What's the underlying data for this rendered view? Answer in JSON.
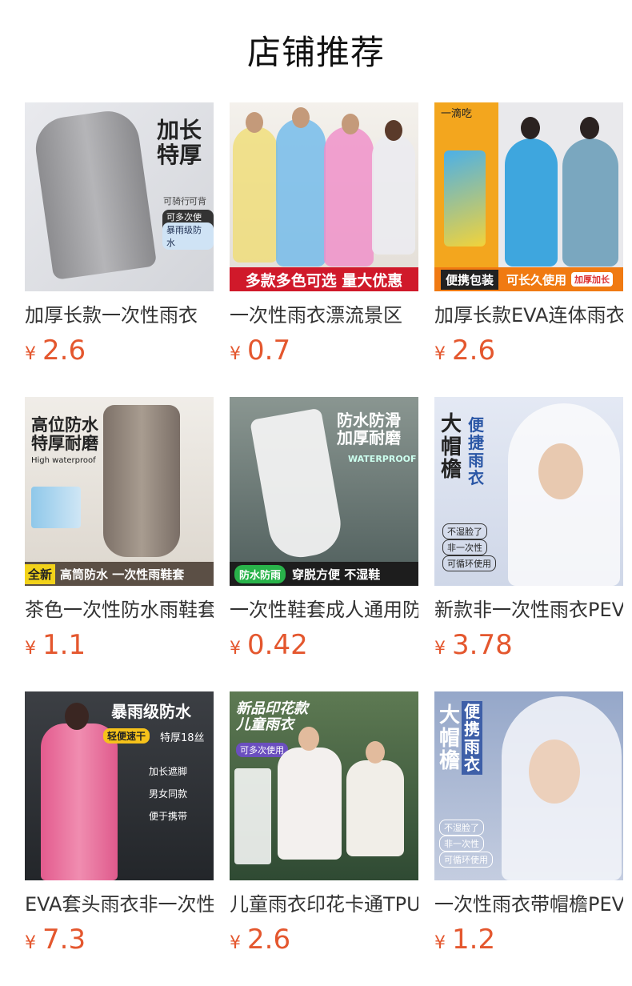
{
  "header": {
    "title": "店铺推荐"
  },
  "currency_symbol": "¥",
  "products": [
    {
      "name": "加厚长款一次性雨衣",
      "price": "2.6",
      "image": {
        "headline": "加长\n特厚",
        "badges": [
          "可多次使用",
          "暴雨级防水"
        ],
        "icons_text": [
          "可骑行",
          "可背包"
        ]
      }
    },
    {
      "name": "一次性雨衣漂流景区",
      "price": "0.7",
      "image": {
        "banner": "多款多色可选 量大优惠"
      }
    },
    {
      "name": "加厚长款EVA连体雨衣",
      "price": "2.6",
      "image": {
        "brand": "一滴吃",
        "banner_left": "便携包装",
        "banner_right": "可长久使用",
        "banner_tag": "加厚加长"
      }
    },
    {
      "name": "茶色一次性防水雨鞋套",
      "price": "1.1",
      "image": {
        "headline": "高位防水\n特厚耐磨",
        "sub": "High waterproof",
        "banner_left": "全新",
        "banner_right": "高筒防水 一次性雨鞋套"
      }
    },
    {
      "name": "一次性鞋套成人通用防滑",
      "price": "0.42",
      "image": {
        "headline": "防水防滑\n加厚耐磨",
        "sub": "WATERPROOF",
        "banner_left": "防水防雨",
        "banner_right": "穿脱方便 不湿鞋"
      }
    },
    {
      "name": "新款非一次性雨衣PEVA",
      "price": "3.78",
      "image": {
        "headline": "大\n帽\n檐",
        "headline2": "便\n捷\n雨\n衣",
        "tags": [
          "不湿脸了",
          "非一次性",
          "可循环使用"
        ]
      }
    },
    {
      "name": "EVA套头雨衣非一次性",
      "price": "7.3",
      "image": {
        "headline": "暴雨级防水",
        "badge": "轻便速干",
        "badge2": "特厚18丝",
        "list": [
          "加长遮脚",
          "男女同款",
          "便于携带"
        ]
      }
    },
    {
      "name": "儿童雨衣印花卡通TPU",
      "price": "2.6",
      "image": {
        "headline": "新品印花款\n儿童雨衣",
        "badge": "可多次使用"
      }
    },
    {
      "name": "一次性雨衣带帽檐PEVA",
      "price": "1.2",
      "image": {
        "headline": "大\n帽\n檐",
        "headline2": "便\n携\n雨\n衣",
        "tags": [
          "不湿脸了",
          "非一次性",
          "可循环使用"
        ]
      }
    }
  ],
  "colors": {
    "price": "#e4572e",
    "title": "#111111",
    "name": "#333333"
  }
}
